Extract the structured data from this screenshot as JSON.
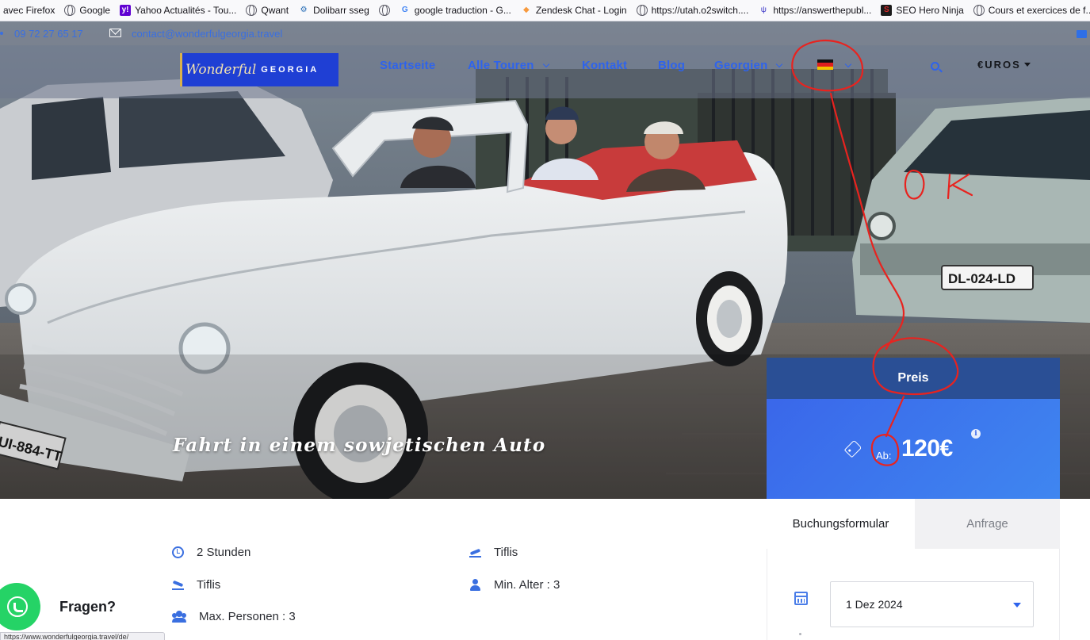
{
  "bookmarks": [
    {
      "icon": "none",
      "label": "avec Firefox"
    },
    {
      "icon": "globe-icon",
      "label": "Google"
    },
    {
      "icon": "yahoo-icon",
      "label": "Yahoo Actualités - Tou..."
    },
    {
      "icon": "globe-icon",
      "label": "Qwant"
    },
    {
      "icon": "dolibarr-icon",
      "label": "Dolibarr sseg"
    },
    {
      "icon": "globe-icon",
      "label": ""
    },
    {
      "icon": "google-icon",
      "label": "google traduction - G..."
    },
    {
      "icon": "zendesk-icon",
      "label": "Zendesk Chat - Login"
    },
    {
      "icon": "globe-icon",
      "label": "https://utah.o2switch...."
    },
    {
      "icon": "answerthepublic-icon",
      "label": "https://answerthepubl..."
    },
    {
      "icon": "seo-hero-icon",
      "label": "SEO Hero Ninja"
    },
    {
      "icon": "globe-icon",
      "label": "Cours et exercices de f..."
    }
  ],
  "topbar": {
    "phone": "09 72 27 65 17",
    "email": "contact@wonderfulgeorgia.travel"
  },
  "logo": {
    "script": "Wonderful",
    "caps": "GEORGIA"
  },
  "nav": {
    "home": "Startseite",
    "tours": "Alle Touren",
    "contact": "Kontakt",
    "blog": "Blog",
    "georgia": "Georgien",
    "language_flag": "de",
    "currency": "€UROS"
  },
  "hero": {
    "title": "Fahrt in einem sowjetischen Auto",
    "license_plate": "DL-024-LD",
    "front_plate": "UI-884-TT"
  },
  "price": {
    "header": "Preis",
    "from": "Ab:",
    "value": "120€",
    "info": "i"
  },
  "booking": {
    "tab_booking": "Buchungsformular",
    "tab_inquiry": "Anfrage",
    "date": "1 Dez 2024"
  },
  "details": {
    "duration": "2 Stunden",
    "departure": "Tiflis",
    "arrival": "Tiflis",
    "min_age": "Min. Alter : 3",
    "max_people": "Max. Personen : 3"
  },
  "chat": {
    "label": "Fragen?"
  },
  "status_bar": {
    "url": "https://www.wonderfulgeorgia.travel/de/"
  },
  "annotation": {
    "text": "OK",
    "color": "#e8231f"
  },
  "colors": {
    "accent_blue": "#2e63ec",
    "price_header": "#2a4f95",
    "price_body": "#3a67ea",
    "whatsapp": "#25d366"
  }
}
